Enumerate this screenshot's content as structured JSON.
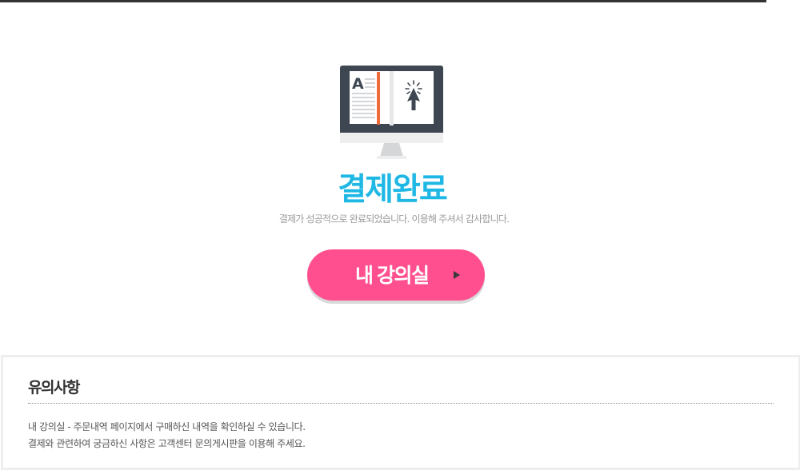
{
  "complete": {
    "title": "결제완료",
    "message": "결제가 성공적으로 완료되었습니다. 이용해 주셔서 감사합니다.",
    "illustration_icon": "monitor-book-icon"
  },
  "cta": {
    "label": "내 강의실",
    "icon": "play-arrow-icon"
  },
  "notice": {
    "title": "유의사항",
    "items": [
      "내 강의실 - 주문내역 페이지에서 구매하신 내역을 확인하실 수 있습니다.",
      "결제와 관련하여 궁금하신 사항은 고객센터 문의게시판을 이용해 주세요."
    ]
  },
  "colors": {
    "title": "#1fb8e4",
    "button": "#ff4f8f",
    "topbar": "#333333"
  }
}
